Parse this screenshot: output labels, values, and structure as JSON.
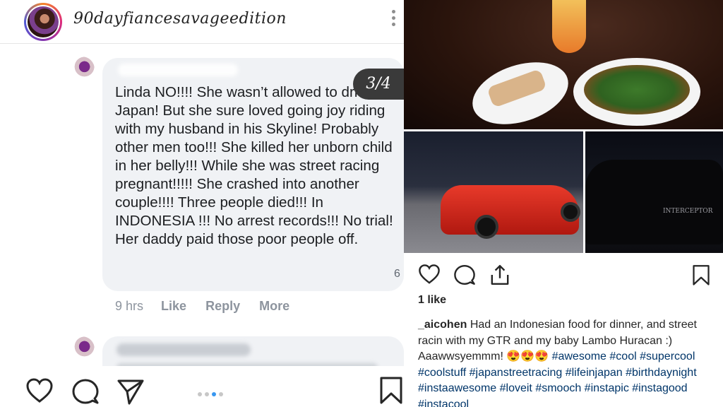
{
  "left_post": {
    "username": "90dayfiancesavageedition",
    "comment_text": "Linda NO!!!! She wasn’t allowed to drive in Japan! But she sure loved going joy riding with my husband in his Skyline! Probably other men too!!! She killed her unborn child in her belly!!! While she was street racing pregnant!!!!! She crashed into another couple!!!! Three people died!!! In INDONESIA !!! No arrest records!!! No trial! Her daddy paid those poor people off.",
    "slide_counter": "3/4",
    "reaction_count": "6",
    "time": "9 hrs",
    "like_label": "Like",
    "reply_label": "Reply",
    "more_label": "More"
  },
  "right_post": {
    "car_badge": "INTERCEPTOR",
    "likes": "1 like",
    "caption_user": "_aicohen",
    "caption_text": "Had an Indonesian food for dinner, and street racin with my GTR and my baby Lambo Huracan :) Aaawwsyemmm! 😍😍😍",
    "hashtags": "#awesome #cool #supercool #coolstuff #japanstreetracing #lifeinjapan #birthdaynight #instaawesome #loveit #smooch #instapic #instagood #instacool"
  },
  "icons": {
    "heart": "heart-icon",
    "comment": "comment-icon",
    "share": "send-icon",
    "bookmark": "bookmark-icon",
    "more": "more-options-icon"
  },
  "colors": {
    "link": "#003569",
    "accent": "#3897f0",
    "fb_bubble": "#f0f2f5",
    "lambo_red": "#e83a2a"
  }
}
